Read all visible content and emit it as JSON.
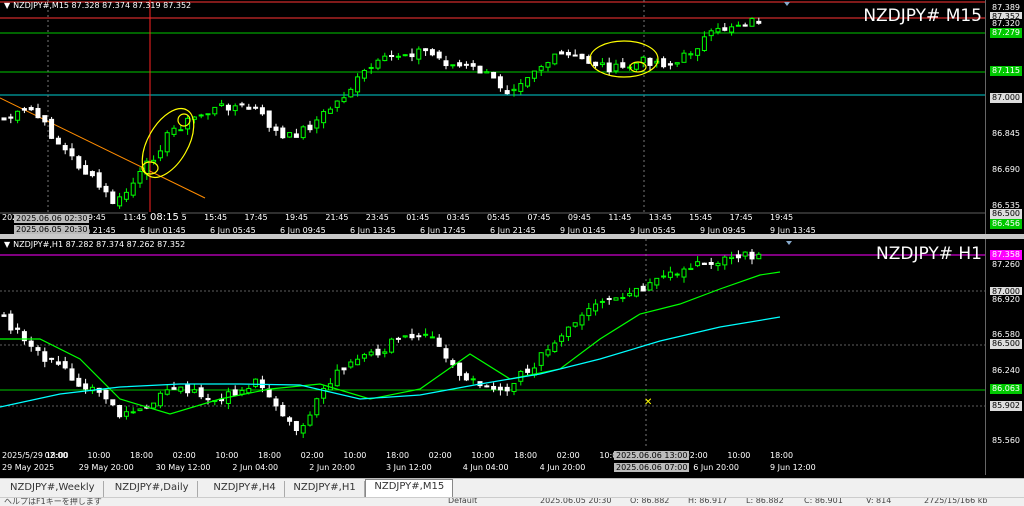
{
  "top_chart": {
    "info_text": "NZDJPY#,M15  87.328 87.374 87.319 87.352",
    "symbol_label": "NZDJPY# M15",
    "price_labels": [
      {
        "text": "87.389",
        "y": 87.389,
        "style": "plain"
      },
      {
        "text": "87.352",
        "y": 87.352,
        "style": "hl"
      },
      {
        "text": "87.320",
        "y": 87.32,
        "style": "plain"
      },
      {
        "text": "87.279",
        "y": 87.279,
        "style": "green"
      },
      {
        "text": "87.115",
        "y": 87.115,
        "style": "green"
      },
      {
        "text": "87.000",
        "y": 87.0,
        "style": "hl"
      },
      {
        "text": "86.845",
        "y": 86.845,
        "style": "plain"
      },
      {
        "text": "86.690",
        "y": 86.69,
        "style": "plain"
      },
      {
        "text": "86.535",
        "y": 86.535,
        "style": "plain"
      },
      {
        "text": "86.500",
        "y": 86.5,
        "style": "hl"
      },
      {
        "text": "86.456",
        "y": 86.456,
        "style": "green"
      }
    ],
    "time_labels": [
      "2025",
      "05:45",
      "09:45",
      "11:45",
      "13:45",
      "15:45",
      "17:45",
      "19:45",
      "21:45",
      "23:45",
      "01:45",
      "03:45",
      "05:45",
      "07:45",
      "09:45",
      "11:45",
      "13:45",
      "15:45",
      "17:45",
      "19:45"
    ],
    "date_labels": [
      "5 Jun 21:45",
      "6 Jun 01:45",
      "6 Jun 05:45",
      "6 Jun 09:45",
      "6 Jun 13:45",
      "6 Jun 17:45",
      "6 Jun 21:45",
      "9 Jun 01:45",
      "9 Jun 05:45",
      "9 Jun 09:45",
      "9 Jun 13:45"
    ],
    "crosshair_time_1": "2025.06.06 02:30",
    "crosshair_time_2": "2025.06.05 20:30",
    "crosshair_label": "08:15"
  },
  "bottom_chart": {
    "info_text": "NZDJPY#,H1  87.282 87.374 87.262 87.352",
    "symbol_label": "NZDJPY# H1",
    "price_labels": [
      {
        "text": "87.358",
        "y": 87.358,
        "style": "mag"
      },
      {
        "text": "87.260",
        "y": 87.26,
        "style": "plain"
      },
      {
        "text": "87.000",
        "y": 87.0,
        "style": "hl"
      },
      {
        "text": "86.920",
        "y": 86.92,
        "style": "plain"
      },
      {
        "text": "86.580",
        "y": 86.58,
        "style": "plain"
      },
      {
        "text": "86.500",
        "y": 86.5,
        "style": "hl"
      },
      {
        "text": "86.240",
        "y": 86.24,
        "style": "plain"
      },
      {
        "text": "86.063",
        "y": 86.063,
        "style": "green"
      },
      {
        "text": "85.902",
        "y": 85.902,
        "style": "hl"
      },
      {
        "text": "85.560",
        "y": 85.56,
        "style": "plain"
      }
    ],
    "time_labels_row1": [
      "2025/5/29 18:00",
      "02:00",
      "10:00",
      "18:00",
      "02:00",
      "10:00",
      "18:00",
      "02:00",
      "10:00",
      "18:00",
      "02:00",
      "10:00",
      "18:00",
      "02:00",
      "10:00",
      "18:00",
      "02:00",
      "10:00",
      "18:00"
    ],
    "time_labels_row2": [
      "29 May 2025",
      "29 May 20:00",
      "30 May 12:00",
      "2 Jun 04:00",
      "2 Jun 20:00",
      "3 Jun 12:00",
      "4 Jun 04:00",
      "4 Jun 20:00",
      "5 Jun 12:00",
      "6 Jun 20:00",
      "9 Jun 12:00"
    ],
    "crosshair_time_1": "2025.06.06 13:00",
    "crosshair_time_2": "2025.06.06 07:00"
  },
  "tabs": [
    {
      "label": "NZDJPY#,Weekly",
      "active": false
    },
    {
      "label": "NZDJPY#,Daily",
      "active": false
    },
    {
      "label": "NZDJPY#,H4",
      "active": false
    },
    {
      "label": "NZDJPY#,H1",
      "active": false
    },
    {
      "label": "NZDJPY#,M15",
      "active": true
    }
  ],
  "status_bar": {
    "left": "ヘルプはF1キーを押します",
    "mode": "Default",
    "datetime": "2025.06.05 20:30",
    "open": "O: 86.882",
    "high": "H: 86.917",
    "low": "L: 86.882",
    "close": "C: 86.901",
    "volume": "V: 814",
    "traffic": "2725/15/166 kb"
  },
  "colors": {
    "background": "#000000",
    "bull": "#00ff00",
    "bear": "#ffffff",
    "ma_green": "#00ff00",
    "ma_cyan": "#00ffff",
    "annotation": "#ffff00",
    "trendline": "#ff8c00"
  }
}
